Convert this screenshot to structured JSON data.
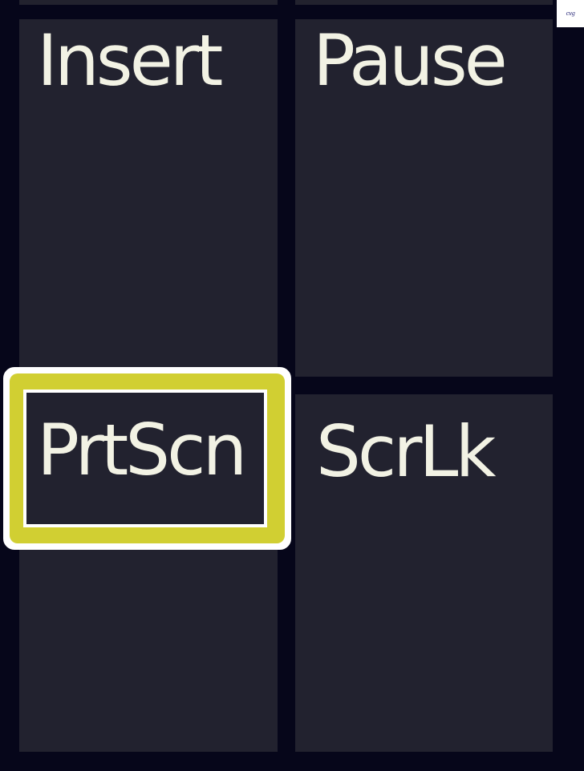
{
  "keyboard": {
    "keys": [
      {
        "label": "Insert"
      },
      {
        "label": "Pause"
      },
      {
        "label": "PrtScn",
        "focused": true
      },
      {
        "label": "ScrLk"
      }
    ],
    "focus_color": "#d1cf32",
    "key_color": "#22222f",
    "background_color": "#06061a"
  },
  "logo": {
    "text": "cvg"
  }
}
